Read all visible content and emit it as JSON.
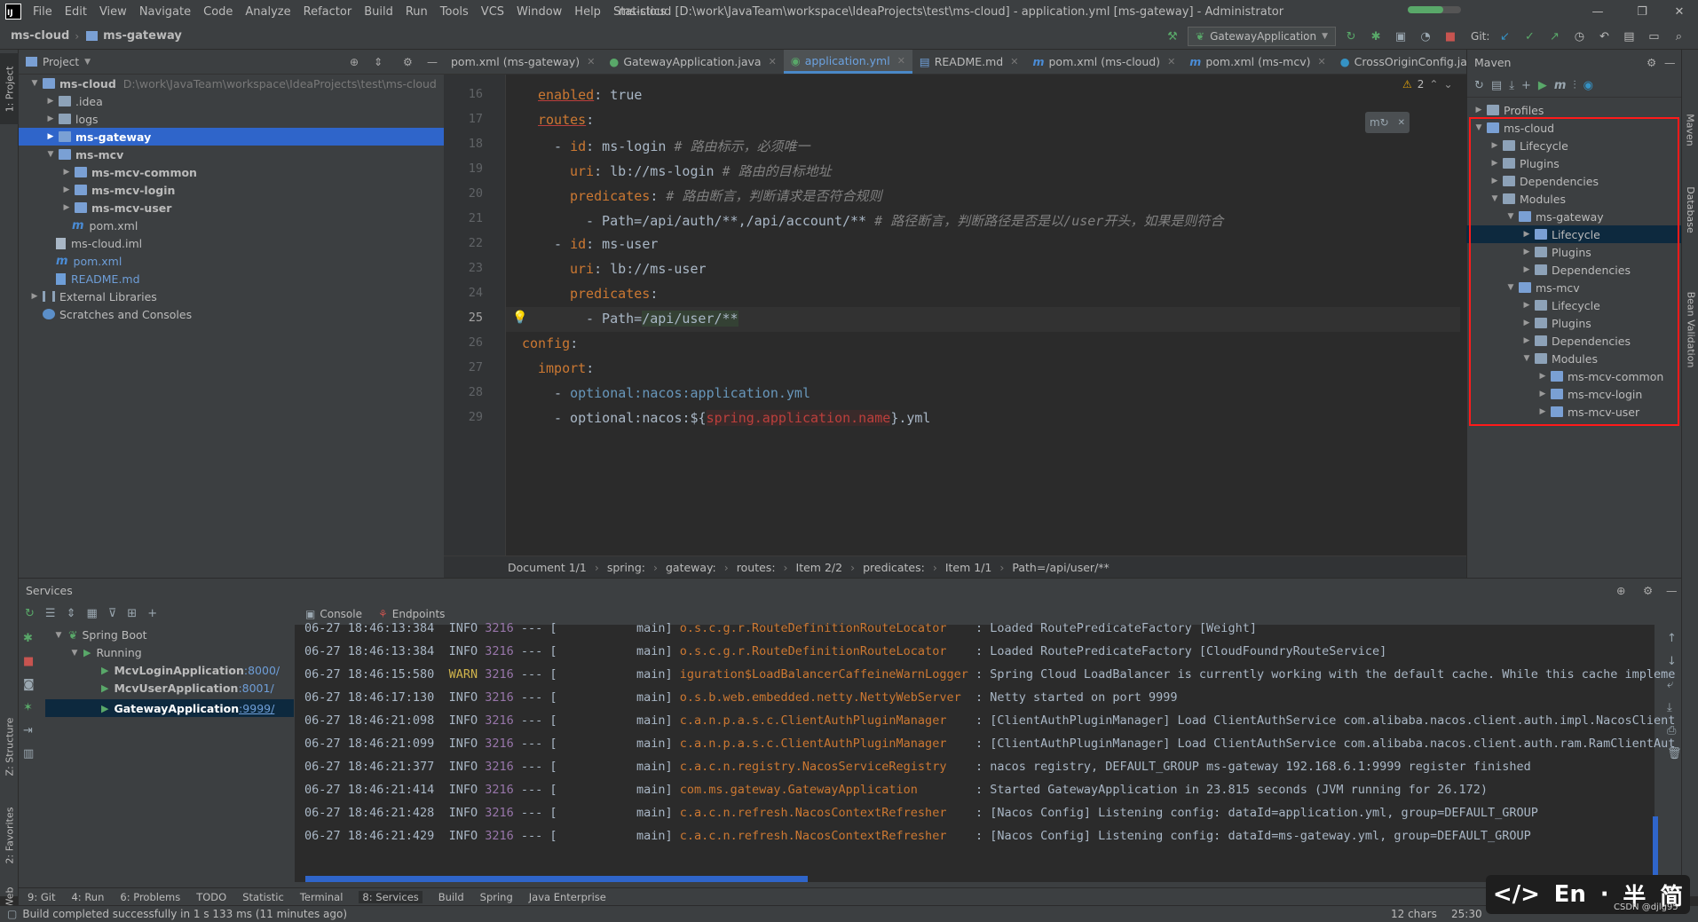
{
  "menubar": {
    "items": [
      "File",
      "Edit",
      "View",
      "Navigate",
      "Code",
      "Analyze",
      "Refactor",
      "Build",
      "Run",
      "Tools",
      "VCS",
      "Window",
      "Help",
      "Statistics"
    ],
    "title": "ms-cloud [D:\\work\\JavaTeam\\workspace\\IdeaProjects\\test\\ms-cloud] - application.yml [ms-gateway] - Administrator"
  },
  "navbar": {
    "crumbs": [
      "ms-cloud",
      "ms-gateway"
    ],
    "run_config": "GatewayApplication",
    "git_label": "Git:"
  },
  "project": {
    "title": "Project",
    "tree": [
      {
        "label": "ms-cloud",
        "path": "D:\\work\\JavaTeam\\workspace\\IdeaProjects\\test\\ms-cloud"
      },
      {
        "label": ".idea"
      },
      {
        "label": "logs"
      },
      {
        "label": "ms-gateway"
      },
      {
        "label": "ms-mcv"
      },
      {
        "label": "ms-mcv-common"
      },
      {
        "label": "ms-mcv-login"
      },
      {
        "label": "ms-mcv-user"
      },
      {
        "label": "pom.xml"
      },
      {
        "label": "ms-cloud.iml"
      },
      {
        "label": "pom.xml"
      },
      {
        "label": "README.md"
      },
      {
        "label": "External Libraries"
      },
      {
        "label": "Scratches and Consoles"
      }
    ]
  },
  "tabs": [
    {
      "label": "pom.xml (ms-gateway)"
    },
    {
      "label": "GatewayApplication.java"
    },
    {
      "label": "application.yml"
    },
    {
      "label": "README.md"
    },
    {
      "label": "pom.xml (ms-cloud)"
    },
    {
      "label": "pom.xml (ms-mcv)"
    },
    {
      "label": "CrossOriginConfig.java"
    }
  ],
  "editor": {
    "warnings": "2",
    "lines": [
      {
        "num": "16"
      },
      {
        "num": "17"
      },
      {
        "num": "18"
      },
      {
        "num": "19"
      },
      {
        "num": "20"
      },
      {
        "num": "21"
      },
      {
        "num": "22"
      },
      {
        "num": "23"
      },
      {
        "num": "24"
      },
      {
        "num": "25"
      },
      {
        "num": "26"
      },
      {
        "num": "27"
      },
      {
        "num": "28"
      },
      {
        "num": "29"
      }
    ],
    "code": {
      "l16_key": "enabled",
      "l16_val": ": true",
      "l17_key": "routes",
      "l18_key": "id",
      "l18_val": ": ms-login ",
      "l18_cm": "# 路由标示，必须唯一",
      "l19_key": "uri",
      "l19_val": ": lb://ms-login ",
      "l19_cm": "# 路由的目标地址",
      "l20_key": "predicates",
      "l20_cm": "# 路由断言，判断请求是否符合规则",
      "l21_val": "- Path=/api/auth/**,/api/account/** ",
      "l21_cm": "# 路径断言，判断路径是否是以/user开头，如果是则符合",
      "l22_key": "id",
      "l22_val": ": ms-user",
      "l23_key": "uri",
      "l23_val": ": lb://ms-user",
      "l24_key": "predicates",
      "l25_pre": "- Path=",
      "l25_hl": "/api/user/**",
      "l26_key": "config",
      "l27_key": "import",
      "l28_pre": "- ",
      "l28_val": "optional:nacos:application.yml",
      "l29_pre": "- optional:nacos:${",
      "l29_var": "spring.application.name",
      "l29_post": "}.yml"
    },
    "breadcrumb": [
      "Document 1/1",
      "spring:",
      "gateway:",
      "routes:",
      "Item 2/2",
      "predicates:",
      "Item 1/1",
      "Path=/api/user/**"
    ]
  },
  "maven": {
    "title": "Maven",
    "tree": [
      {
        "label": "Profiles"
      },
      {
        "label": "ms-cloud"
      },
      {
        "label": "Lifecycle"
      },
      {
        "label": "Plugins"
      },
      {
        "label": "Dependencies"
      },
      {
        "label": "Modules"
      },
      {
        "label": "ms-gateway"
      },
      {
        "label": "Lifecycle"
      },
      {
        "label": "Plugins"
      },
      {
        "label": "Dependencies"
      },
      {
        "label": "ms-mcv"
      },
      {
        "label": "Lifecycle"
      },
      {
        "label": "Plugins"
      },
      {
        "label": "Dependencies"
      },
      {
        "label": "Modules"
      },
      {
        "label": "ms-mcv-common"
      },
      {
        "label": "ms-mcv-login"
      },
      {
        "label": "ms-mcv-user"
      }
    ]
  },
  "services": {
    "title": "Services",
    "tabs": [
      "Console",
      "Endpoints"
    ],
    "tree": {
      "root": "Spring Boot",
      "group": "Running",
      "apps": [
        {
          "name": "McvLoginApplication",
          "port": ":8000/"
        },
        {
          "name": "McvUserApplication",
          "port": ":8001/"
        },
        {
          "name": "GatewayApplication",
          "port": ":9999/"
        }
      ]
    },
    "console": [
      {
        "time": "06-27 18:46:13:384",
        "level": "INFO",
        "pid": "3216",
        "sep": "--- [",
        "thread": "main]",
        "cls": "o.s.c.g.r.RouteDefinitionRouteLocator",
        "msg": ": Loaded RoutePredicateFactory [Weight]"
      },
      {
        "time": "06-27 18:46:13:384",
        "level": "INFO",
        "pid": "3216",
        "sep": "--- [",
        "thread": "main]",
        "cls": "o.s.c.g.r.RouteDefinitionRouteLocator",
        "msg": ": Loaded RoutePredicateFactory [CloudFoundryRouteService]"
      },
      {
        "time": "06-27 18:46:15:580",
        "level": "WARN",
        "pid": "3216",
        "sep": "--- [",
        "thread": "main]",
        "cls": "iguration$LoadBalancerCaffeineWarnLogger",
        "msg": ": Spring Cloud LoadBalancer is currently working with the default cache. While this cache impleme"
      },
      {
        "time": "06-27 18:46:17:130",
        "level": "INFO",
        "pid": "3216",
        "sep": "--- [",
        "thread": "main]",
        "cls": "o.s.b.web.embedded.netty.NettyWebServer",
        "msg": ": Netty started on port 9999"
      },
      {
        "time": "06-27 18:46:21:098",
        "level": "INFO",
        "pid": "3216",
        "sep": "--- [",
        "thread": "main]",
        "cls": "c.a.n.p.a.s.c.ClientAuthPluginManager",
        "msg": ": [ClientAuthPluginManager] Load ClientAuthService com.alibaba.nacos.client.auth.impl.NacosClient"
      },
      {
        "time": "06-27 18:46:21:099",
        "level": "INFO",
        "pid": "3216",
        "sep": "--- [",
        "thread": "main]",
        "cls": "c.a.n.p.a.s.c.ClientAuthPluginManager",
        "msg": ": [ClientAuthPluginManager] Load ClientAuthService com.alibaba.nacos.client.auth.ram.RamClientAut"
      },
      {
        "time": "06-27 18:46:21:377",
        "level": "INFO",
        "pid": "3216",
        "sep": "--- [",
        "thread": "main]",
        "cls": "c.a.c.n.registry.NacosServiceRegistry",
        "msg": ": nacos registry, DEFAULT_GROUP ms-gateway 192.168.6.1:9999 register finished"
      },
      {
        "time": "06-27 18:46:21:414",
        "level": "INFO",
        "pid": "3216",
        "sep": "--- [",
        "thread": "main]",
        "cls": "com.ms.gateway.GatewayApplication",
        "msg": ": Started GatewayApplication in 23.815 seconds (JVM running for 26.172)"
      },
      {
        "time": "06-27 18:46:21:428",
        "level": "INFO",
        "pid": "3216",
        "sep": "--- [",
        "thread": "main]",
        "cls": "c.a.c.n.refresh.NacosContextRefresher",
        "msg": ": [Nacos Config] Listening config: dataId=application.yml, group=DEFAULT_GROUP"
      },
      {
        "time": "06-27 18:46:21:429",
        "level": "INFO",
        "pid": "3216",
        "sep": "--- [",
        "thread": "main]",
        "cls": "c.a.c.n.refresh.NacosContextRefresher",
        "msg": ": [Nacos Config] Listening config: dataId=ms-gateway.yml, group=DEFAULT_GROUP"
      }
    ]
  },
  "toolstrip": [
    "9: Git",
    "4: Run",
    "6: Problems",
    "TODO",
    "Statistic",
    "Terminal",
    "8: Services",
    "Build",
    "Spring",
    "Java Enterprise"
  ],
  "statusbar": {
    "message": "Build completed successfully in 1 s 133 ms (11 minutes ago)",
    "chars": "12 chars",
    "pos": "25:30"
  },
  "leftstrip": [
    "1: Project",
    "Z: Structure",
    "2: Favorites",
    "Web"
  ],
  "rightstrip": [
    "Maven",
    "Database",
    "Bean Validation"
  ],
  "ime": {
    "a": "</>",
    "b": "En",
    "c": "·",
    "d": "半",
    "e": "简"
  },
  "watermark": "CSDN @djlg95"
}
